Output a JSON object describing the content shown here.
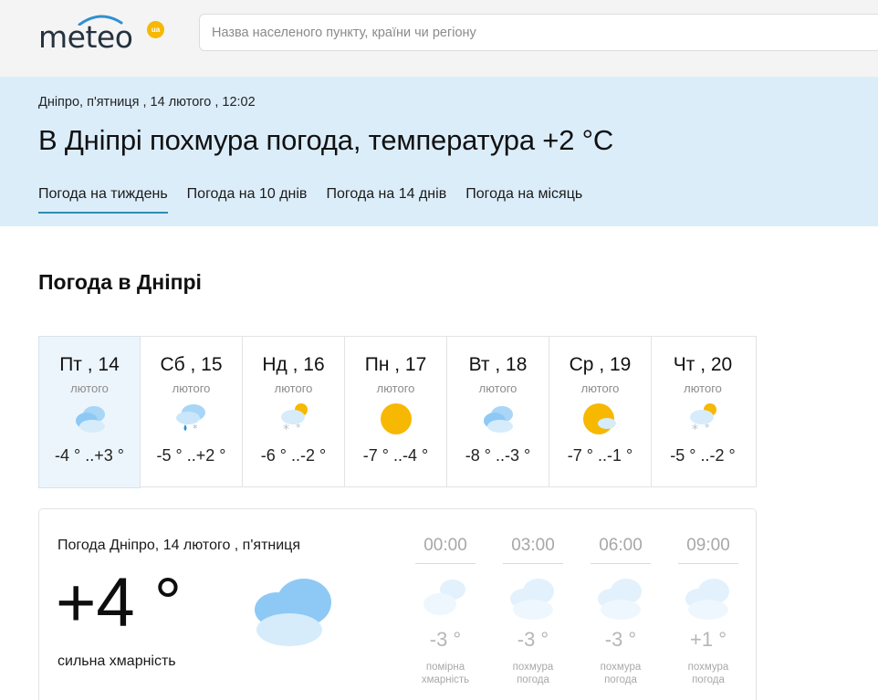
{
  "header": {
    "logo_text": "meteo",
    "logo_badge": "ua",
    "search_placeholder": "Назва населеного пункту, країни чи регіону"
  },
  "hero": {
    "breadcrumb": "Дніпро, п'ятниця , 14 лютого , 12:02",
    "headline": "В Дніпрі похмура погода, температура +2 °C",
    "tabs": [
      {
        "label": "Погода на тиждень",
        "active": true
      },
      {
        "label": "Погода на 10 днів",
        "active": false
      },
      {
        "label": "Погода на 14 днів",
        "active": false
      },
      {
        "label": "Погода на місяць",
        "active": false
      }
    ]
  },
  "section_title": "Погода в Дніпрі",
  "week": [
    {
      "day": "Пт , 14",
      "month": "лютого",
      "icon": "cloudy-icon",
      "temp": "-4 ° ..+3 °"
    },
    {
      "day": "Сб , 15",
      "month": "лютого",
      "icon": "rain-snow-icon",
      "temp": "-5 ° ..+2 °"
    },
    {
      "day": "Нд , 16",
      "month": "лютого",
      "icon": "partly-cloudy-snow-icon",
      "temp": "-6 ° ..-2 °"
    },
    {
      "day": "Пн , 17",
      "month": "лютого",
      "icon": "sun-icon",
      "temp": "-7 ° ..-4 °"
    },
    {
      "day": "Вт , 18",
      "month": "лютого",
      "icon": "cloudy-icon",
      "temp": "-8 ° ..-3 °"
    },
    {
      "day": "Ср , 19",
      "month": "лютого",
      "icon": "sun-cloud-icon",
      "temp": "-7 ° ..-1 °"
    },
    {
      "day": "Чт , 20",
      "month": "лютого",
      "icon": "partly-cloudy-snow-icon",
      "temp": "-5 ° ..-2 °"
    }
  ],
  "detail": {
    "title": "Погода Дніпро, 14 лютого , п'ятниця",
    "temp": "+4 °",
    "condition": "сильна хмарність",
    "hours": [
      {
        "time": "00:00",
        "temp": "-3 °",
        "desc": "помірна хмарність"
      },
      {
        "time": "03:00",
        "temp": "-3 °",
        "desc": "похмура погода"
      },
      {
        "time": "06:00",
        "temp": "-3 °",
        "desc": "похмура погода"
      },
      {
        "time": "09:00",
        "temp": "+1 °",
        "desc": "похмура погода"
      }
    ]
  },
  "colors": {
    "header_bg": "#f4f4f4",
    "hero_bg": "#dcedfa",
    "active_tab_underline": "#2a8fb0",
    "sun": "#f6b800",
    "cloud": "#8ec9f5"
  }
}
